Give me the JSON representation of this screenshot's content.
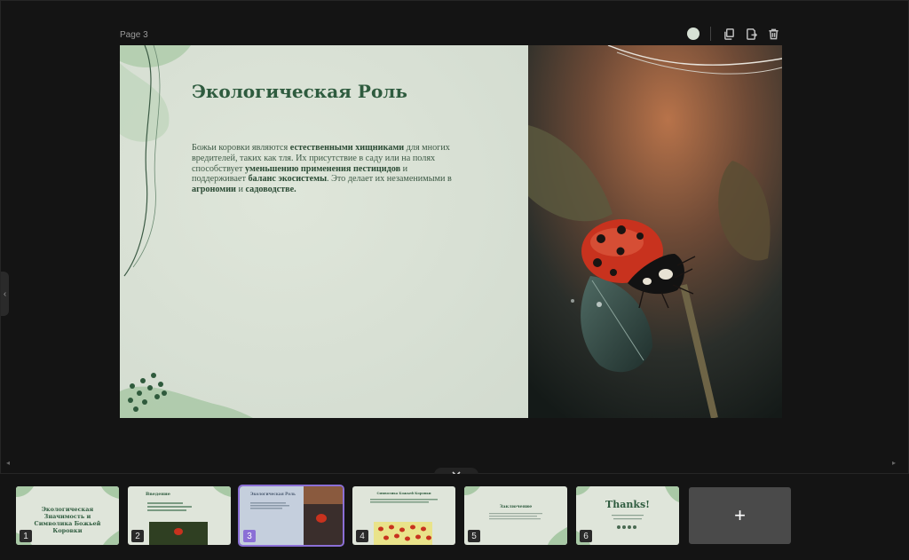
{
  "editor": {
    "page_label": "Page 3",
    "actions": [
      {
        "name": "bg-color-dot",
        "icon": "color-circle"
      },
      {
        "name": "duplicate-page",
        "icon": "copy-icon"
      },
      {
        "name": "export-page",
        "icon": "export-icon"
      },
      {
        "name": "delete-page",
        "icon": "trash-icon"
      }
    ]
  },
  "slide": {
    "title": "Экологическая Роль",
    "body_parts": [
      {
        "t": "Божьи коровки являются ",
        "b": false
      },
      {
        "t": "естественными хищниками",
        "b": true
      },
      {
        "t": " для многих вредителей, таких как тля. Их присутствие в саду или на полях способствует ",
        "b": false
      },
      {
        "t": "уменьшению применения пестицидов",
        "b": true
      },
      {
        "t": " и поддерживает ",
        "b": false
      },
      {
        "t": "баланс экосистемы",
        "b": true
      },
      {
        "t": ". Это делает их незаменимыми в ",
        "b": false
      },
      {
        "t": "агрономии",
        "b": true
      },
      {
        "t": " и ",
        "b": false
      },
      {
        "t": "садоводстве.",
        "b": true
      }
    ],
    "colors": {
      "title": "#2e5b3e",
      "accent": "#8fb89a"
    }
  },
  "thumbnails": [
    {
      "num": "1",
      "title": "Экологическая Значимость и Символика Божьей Коровки"
    },
    {
      "num": "2",
      "title": "Введение"
    },
    {
      "num": "3",
      "title": "Экологическая Роль",
      "selected": true
    },
    {
      "num": "4",
      "title": "Символика Божьей Коровки"
    },
    {
      "num": "5",
      "title": "Заключение"
    },
    {
      "num": "6",
      "title": "Thanks!"
    }
  ],
  "add_label": "+",
  "nav": {
    "collapse_icon": "chevron-down-icon",
    "side_handle": "‹"
  }
}
